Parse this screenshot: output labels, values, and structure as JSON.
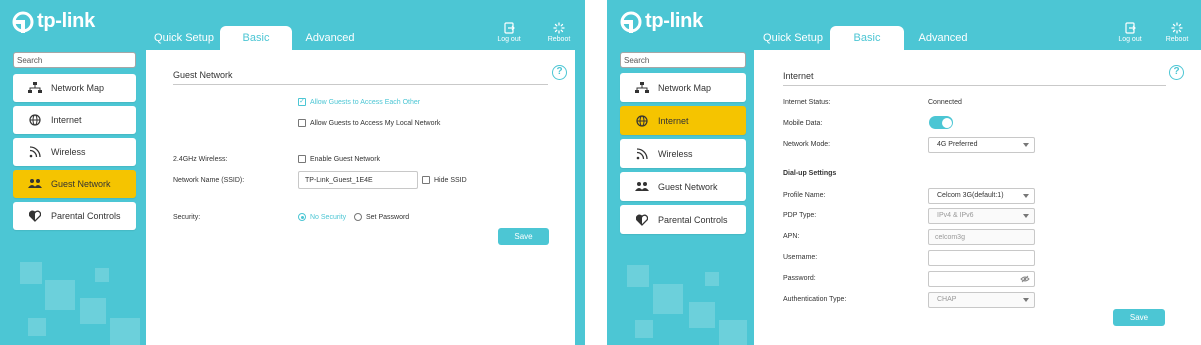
{
  "colors": {
    "brand": "#4cc6d4",
    "active_menu": "#f5c400",
    "text": "#333333"
  },
  "left": {
    "logo_text": "tp-link",
    "tabs": [
      {
        "label": "Quick Setup",
        "active": false
      },
      {
        "label": "Basic",
        "active": true
      },
      {
        "label": "Advanced",
        "active": false
      }
    ],
    "logout_label": "Log out",
    "reboot_label": "Reboot",
    "search_placeholder": "Search",
    "menu": [
      {
        "label": "Network Map",
        "icon": "network-map-icon",
        "active": false
      },
      {
        "label": "Internet",
        "icon": "globe-icon",
        "active": false
      },
      {
        "label": "Wireless",
        "icon": "wireless-icon",
        "active": false
      },
      {
        "label": "Guest Network",
        "icon": "guest-network-icon",
        "active": true
      },
      {
        "label": "Parental Controls",
        "icon": "parental-controls-icon",
        "active": false
      }
    ],
    "section_title": "Guest Network",
    "allow_each_other": "Allow Guests to Access Each Other",
    "allow_local": "Allow Guests to Access My Local Network",
    "wireless_label": "2.4GHz Wireless:",
    "enable_guest": "Enable Guest Network",
    "ssid_label": "Network Name (SSID):",
    "ssid_value": "TP-Link_Guest_1E4E",
    "hide_ssid": "Hide SSID",
    "security_label": "Security:",
    "no_security": "No Security",
    "set_password": "Set Password",
    "save_label": "Save"
  },
  "right": {
    "logo_text": "tp-link",
    "tabs": [
      {
        "label": "Quick Setup",
        "active": false
      },
      {
        "label": "Basic",
        "active": true
      },
      {
        "label": "Advanced",
        "active": false
      }
    ],
    "logout_label": "Log out",
    "reboot_label": "Reboot",
    "search_placeholder": "Search",
    "menu": [
      {
        "label": "Network Map",
        "icon": "network-map-icon",
        "active": false
      },
      {
        "label": "Internet",
        "icon": "globe-icon",
        "active": true
      },
      {
        "label": "Wireless",
        "icon": "wireless-icon",
        "active": false
      },
      {
        "label": "Guest Network",
        "icon": "guest-network-icon",
        "active": false
      },
      {
        "label": "Parental Controls",
        "icon": "parental-controls-icon",
        "active": false
      }
    ],
    "section_title": "Internet",
    "internet_status_label": "Internet Status:",
    "internet_status_value": "Connected",
    "mobile_data_label": "Mobile Data:",
    "network_mode_label": "Network Mode:",
    "network_mode_value": "4G Preferred",
    "dialup_title": "Dial-up Settings",
    "profile_name_label": "Profile Name:",
    "profile_name_value": "Celcom 3G(default:1)",
    "pdp_type_label": "PDP Type:",
    "pdp_type_value": "IPv4 & IPv6",
    "apn_label": "APN:",
    "apn_value": "celcom3g",
    "username_label": "Username:",
    "password_label": "Password:",
    "auth_type_label": "Authentication Type:",
    "auth_type_value": "CHAP",
    "save_label": "Save"
  }
}
